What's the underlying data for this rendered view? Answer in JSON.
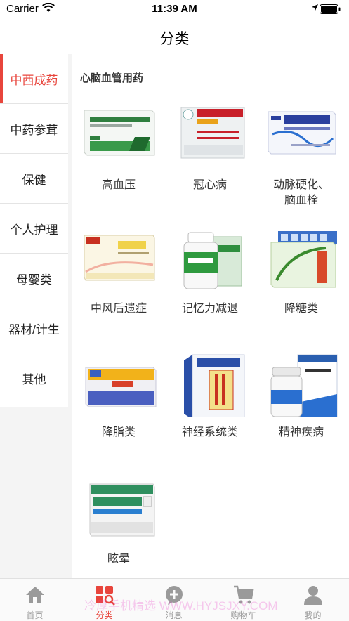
{
  "status": {
    "carrier": "Carrier",
    "time": "11:39 AM"
  },
  "nav": {
    "title": "分类"
  },
  "sidebar": {
    "items": [
      {
        "label": "中西成药",
        "active": true
      },
      {
        "label": "中药参茸"
      },
      {
        "label": "保健"
      },
      {
        "label": "个人护理"
      },
      {
        "label": "母婴类"
      },
      {
        "label": "器材/计生"
      },
      {
        "label": "其他"
      }
    ]
  },
  "section": {
    "title": "心脑血管用药"
  },
  "grid": [
    {
      "label": "高血压",
      "icon": "hypertension-medicine-box"
    },
    {
      "label": "冠心病",
      "icon": "coronary-medicine-box"
    },
    {
      "label": "动脉硬化、\n脑血栓",
      "line1": "动脉硬化、",
      "line2": "脑血栓",
      "icon": "arteriosclerosis-medicine-box"
    },
    {
      "label": "中风后遗症",
      "icon": "stroke-medicine-box"
    },
    {
      "label": "记忆力减退",
      "icon": "memory-medicine-bottle"
    },
    {
      "label": "降糖类",
      "icon": "diabetes-medicine-box"
    },
    {
      "label": "降脂类",
      "icon": "lipid-medicine-box"
    },
    {
      "label": "神经系统类",
      "icon": "nervous-medicine-box"
    },
    {
      "label": "精神疾病",
      "icon": "psychiatric-medicine-box"
    },
    {
      "label": "眩晕",
      "icon": "vertigo-medicine-box"
    }
  ],
  "tabbar": {
    "tabs": [
      {
        "label": "首页",
        "icon": "home-icon"
      },
      {
        "label": "分类",
        "icon": "category-icon",
        "active": true
      },
      {
        "label": "消息",
        "icon": "message-icon"
      },
      {
        "label": "购物车",
        "icon": "cart-icon"
      },
      {
        "label": "我的",
        "icon": "profile-icon"
      }
    ]
  },
  "watermark": "冷厚手机精选 WWW.HYJSJXY.COM",
  "colors": {
    "accent": "#e8453c",
    "sidebar_bg": "#f4f4f4",
    "tab_inactive": "#999999"
  }
}
